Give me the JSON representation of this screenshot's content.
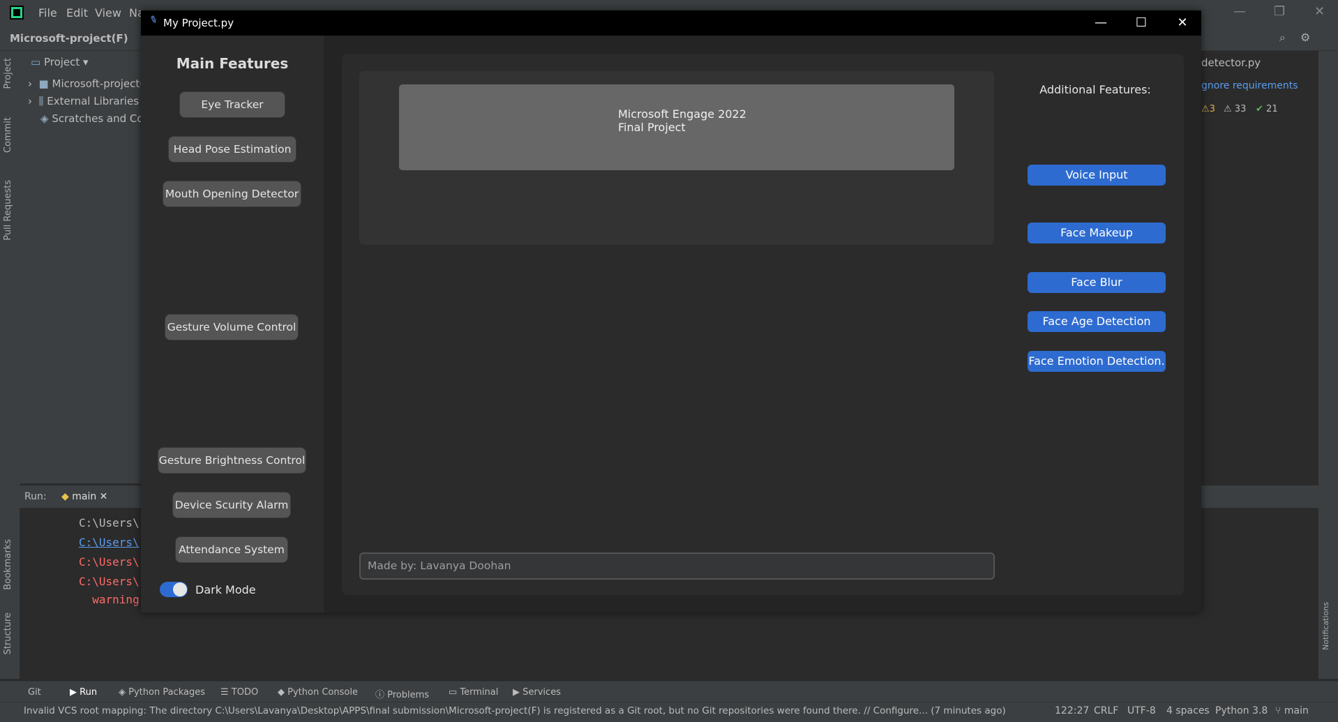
{
  "ide": {
    "menu": [
      "File",
      "Edit",
      "View",
      "Na"
    ],
    "breadcrumb": "Microsoft-project(F)",
    "left_tabs": [
      "Project",
      "Commit",
      "Pull Requests",
      "Bookmarks",
      "Structure"
    ],
    "project_header": "Project",
    "tree": [
      "Microsoft-project(",
      "External Libraries",
      "Scratches and Con"
    ],
    "editor_tab": "detector.py",
    "inspection": {
      "notice": "gnore requirements",
      "warn1": "3",
      "warn2": "33",
      "ok": "21"
    },
    "run_label": "Run:",
    "run_tab": "main",
    "console_lines": [
      "C:\\Users\\",
      "C:\\Users\\",
      "C:\\Users\\",
      "C:\\Users\\",
      "  warning"
    ],
    "tool_tabs": [
      "Git",
      "Run",
      "Python Packages",
      "TODO",
      "Python Console",
      "Problems",
      "Terminal",
      "Services"
    ],
    "status_message": "Invalid VCS root mapping: The directory C:\\Users\\Lavanya\\Desktop\\APPS\\final submission\\Microsoft-project(F) is registered as a Git root, but no Git repositories were found there. // Configure... (7 minutes ago)",
    "status_right": {
      "position": "122:27",
      "line_sep": "CRLF",
      "encoding": "UTF-8",
      "indent": "4 spaces",
      "interpreter": "Python 3.8",
      "branch": "main"
    },
    "notifications": "Notifications"
  },
  "app": {
    "title": "My Project.py",
    "main_features_title": "Main Features",
    "main_buttons": [
      "Eye Tracker",
      "Head Pose Estimation",
      "Mouth Opening Detector",
      "Gesture Volume Control",
      "Gesture Brightness Control",
      "Device Scurity Alarm",
      "Attendance System"
    ],
    "dark_mode_label": "Dark Mode",
    "dark_mode_on": true,
    "banner_line1": "Microsoft Engage 2022",
    "banner_line2": "Final Project",
    "additional_title": "Additional Features:",
    "additional_buttons": [
      "Voice Input",
      "Face Makeup",
      "Face Blur",
      "Face Age Detection",
      "Face Emotion Detection."
    ],
    "made_by_placeholder": "Made by: Lavanya Doohan"
  },
  "colors": {
    "accent": "#2e6bd0",
    "button_gray": "#555555",
    "window_bg": "#242424"
  }
}
